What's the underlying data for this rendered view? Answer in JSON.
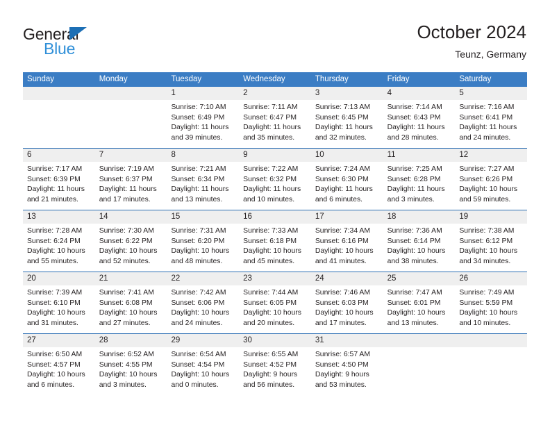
{
  "brand": {
    "name_top": "General",
    "name_bottom": "Blue",
    "accent_color": "#2f8fd8",
    "triangle_color": "#1c6fb5"
  },
  "header": {
    "title": "October 2024",
    "subtitle": "Teunz, Germany"
  },
  "theme": {
    "header_row_bg": "#3b7dc4",
    "week_divider": "#2a6db3",
    "day_band_bg": "#efefef",
    "text_color": "#231f20"
  },
  "weekdays": [
    "Sunday",
    "Monday",
    "Tuesday",
    "Wednesday",
    "Thursday",
    "Friday",
    "Saturday"
  ],
  "weeks": [
    [
      {
        "day": "",
        "sunrise": "",
        "sunset": "",
        "daylight": "",
        "empty": true
      },
      {
        "day": "",
        "sunrise": "",
        "sunset": "",
        "daylight": "",
        "empty": true
      },
      {
        "day": "1",
        "sunrise": "Sunrise: 7:10 AM",
        "sunset": "Sunset: 6:49 PM",
        "daylight": "Daylight: 11 hours and 39 minutes."
      },
      {
        "day": "2",
        "sunrise": "Sunrise: 7:11 AM",
        "sunset": "Sunset: 6:47 PM",
        "daylight": "Daylight: 11 hours and 35 minutes."
      },
      {
        "day": "3",
        "sunrise": "Sunrise: 7:13 AM",
        "sunset": "Sunset: 6:45 PM",
        "daylight": "Daylight: 11 hours and 32 minutes."
      },
      {
        "day": "4",
        "sunrise": "Sunrise: 7:14 AM",
        "sunset": "Sunset: 6:43 PM",
        "daylight": "Daylight: 11 hours and 28 minutes."
      },
      {
        "day": "5",
        "sunrise": "Sunrise: 7:16 AM",
        "sunset": "Sunset: 6:41 PM",
        "daylight": "Daylight: 11 hours and 24 minutes."
      }
    ],
    [
      {
        "day": "6",
        "sunrise": "Sunrise: 7:17 AM",
        "sunset": "Sunset: 6:39 PM",
        "daylight": "Daylight: 11 hours and 21 minutes."
      },
      {
        "day": "7",
        "sunrise": "Sunrise: 7:19 AM",
        "sunset": "Sunset: 6:37 PM",
        "daylight": "Daylight: 11 hours and 17 minutes."
      },
      {
        "day": "8",
        "sunrise": "Sunrise: 7:21 AM",
        "sunset": "Sunset: 6:34 PM",
        "daylight": "Daylight: 11 hours and 13 minutes."
      },
      {
        "day": "9",
        "sunrise": "Sunrise: 7:22 AM",
        "sunset": "Sunset: 6:32 PM",
        "daylight": "Daylight: 11 hours and 10 minutes."
      },
      {
        "day": "10",
        "sunrise": "Sunrise: 7:24 AM",
        "sunset": "Sunset: 6:30 PM",
        "daylight": "Daylight: 11 hours and 6 minutes."
      },
      {
        "day": "11",
        "sunrise": "Sunrise: 7:25 AM",
        "sunset": "Sunset: 6:28 PM",
        "daylight": "Daylight: 11 hours and 3 minutes."
      },
      {
        "day": "12",
        "sunrise": "Sunrise: 7:27 AM",
        "sunset": "Sunset: 6:26 PM",
        "daylight": "Daylight: 10 hours and 59 minutes."
      }
    ],
    [
      {
        "day": "13",
        "sunrise": "Sunrise: 7:28 AM",
        "sunset": "Sunset: 6:24 PM",
        "daylight": "Daylight: 10 hours and 55 minutes."
      },
      {
        "day": "14",
        "sunrise": "Sunrise: 7:30 AM",
        "sunset": "Sunset: 6:22 PM",
        "daylight": "Daylight: 10 hours and 52 minutes."
      },
      {
        "day": "15",
        "sunrise": "Sunrise: 7:31 AM",
        "sunset": "Sunset: 6:20 PM",
        "daylight": "Daylight: 10 hours and 48 minutes."
      },
      {
        "day": "16",
        "sunrise": "Sunrise: 7:33 AM",
        "sunset": "Sunset: 6:18 PM",
        "daylight": "Daylight: 10 hours and 45 minutes."
      },
      {
        "day": "17",
        "sunrise": "Sunrise: 7:34 AM",
        "sunset": "Sunset: 6:16 PM",
        "daylight": "Daylight: 10 hours and 41 minutes."
      },
      {
        "day": "18",
        "sunrise": "Sunrise: 7:36 AM",
        "sunset": "Sunset: 6:14 PM",
        "daylight": "Daylight: 10 hours and 38 minutes."
      },
      {
        "day": "19",
        "sunrise": "Sunrise: 7:38 AM",
        "sunset": "Sunset: 6:12 PM",
        "daylight": "Daylight: 10 hours and 34 minutes."
      }
    ],
    [
      {
        "day": "20",
        "sunrise": "Sunrise: 7:39 AM",
        "sunset": "Sunset: 6:10 PM",
        "daylight": "Daylight: 10 hours and 31 minutes."
      },
      {
        "day": "21",
        "sunrise": "Sunrise: 7:41 AM",
        "sunset": "Sunset: 6:08 PM",
        "daylight": "Daylight: 10 hours and 27 minutes."
      },
      {
        "day": "22",
        "sunrise": "Sunrise: 7:42 AM",
        "sunset": "Sunset: 6:06 PM",
        "daylight": "Daylight: 10 hours and 24 minutes."
      },
      {
        "day": "23",
        "sunrise": "Sunrise: 7:44 AM",
        "sunset": "Sunset: 6:05 PM",
        "daylight": "Daylight: 10 hours and 20 minutes."
      },
      {
        "day": "24",
        "sunrise": "Sunrise: 7:46 AM",
        "sunset": "Sunset: 6:03 PM",
        "daylight": "Daylight: 10 hours and 17 minutes."
      },
      {
        "day": "25",
        "sunrise": "Sunrise: 7:47 AM",
        "sunset": "Sunset: 6:01 PM",
        "daylight": "Daylight: 10 hours and 13 minutes."
      },
      {
        "day": "26",
        "sunrise": "Sunrise: 7:49 AM",
        "sunset": "Sunset: 5:59 PM",
        "daylight": "Daylight: 10 hours and 10 minutes."
      }
    ],
    [
      {
        "day": "27",
        "sunrise": "Sunrise: 6:50 AM",
        "sunset": "Sunset: 4:57 PM",
        "daylight": "Daylight: 10 hours and 6 minutes."
      },
      {
        "day": "28",
        "sunrise": "Sunrise: 6:52 AM",
        "sunset": "Sunset: 4:55 PM",
        "daylight": "Daylight: 10 hours and 3 minutes."
      },
      {
        "day": "29",
        "sunrise": "Sunrise: 6:54 AM",
        "sunset": "Sunset: 4:54 PM",
        "daylight": "Daylight: 10 hours and 0 minutes."
      },
      {
        "day": "30",
        "sunrise": "Sunrise: 6:55 AM",
        "sunset": "Sunset: 4:52 PM",
        "daylight": "Daylight: 9 hours and 56 minutes."
      },
      {
        "day": "31",
        "sunrise": "Sunrise: 6:57 AM",
        "sunset": "Sunset: 4:50 PM",
        "daylight": "Daylight: 9 hours and 53 minutes."
      },
      {
        "day": "",
        "sunrise": "",
        "sunset": "",
        "daylight": "",
        "empty": true
      },
      {
        "day": "",
        "sunrise": "",
        "sunset": "",
        "daylight": "",
        "empty": true
      }
    ]
  ]
}
